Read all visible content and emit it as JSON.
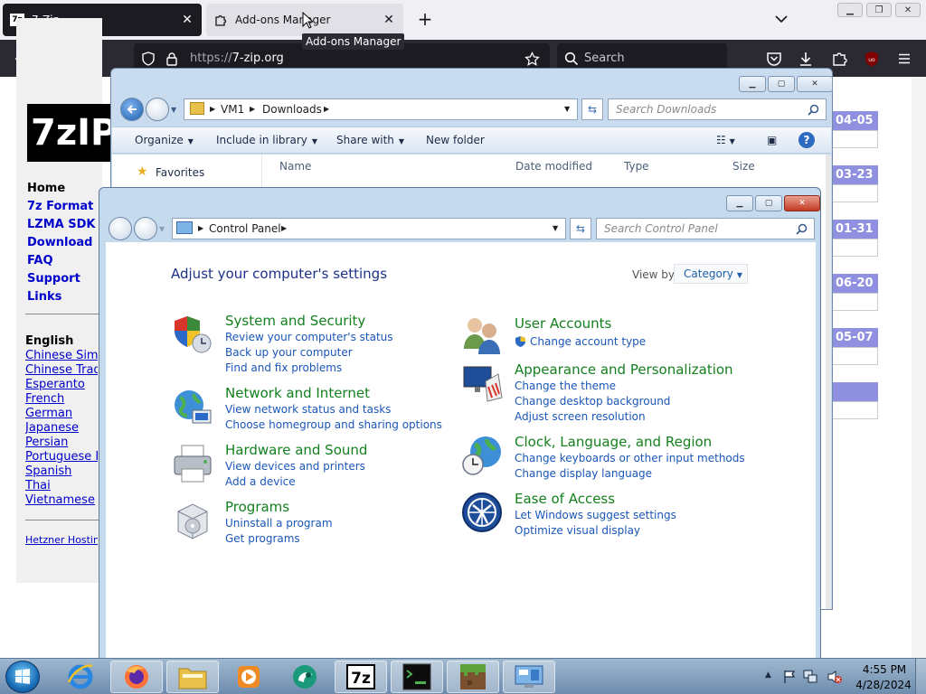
{
  "firefox": {
    "tabs": [
      {
        "label": "7-Zip",
        "icon": "7z-favicon"
      },
      {
        "label": "Add-ons Manager",
        "icon": "puzzle-icon"
      }
    ],
    "tooltip": "Add-ons Manager",
    "url": {
      "scheme": "https://",
      "host": "7-zip.org"
    },
    "search_placeholder": "Search"
  },
  "page": {
    "logo_text": "7zIP",
    "nav": [
      "Home",
      "7z Format",
      "LZMA SDK",
      "Download",
      "FAQ",
      "Support",
      "Links"
    ],
    "lang_heading": "English",
    "languages": [
      "Chinese Simp",
      "Chinese Trad",
      "Esperanto",
      "French",
      "German",
      "Japanese",
      "Persian",
      "Portuguese B",
      "Spanish",
      "Thai",
      "Vietnamese"
    ],
    "hosting": "Hetzner Hostin",
    "dates": [
      "04-05",
      "03-23",
      "01-31",
      "06-20",
      "05-07"
    ]
  },
  "explorer": {
    "breadcrumb": [
      "VM1",
      "Downloads"
    ],
    "search_placeholder": "Search Downloads",
    "commands": [
      "Organize",
      "Include in library",
      "Share with",
      "New folder"
    ],
    "favorites": "Favorites",
    "columns": [
      "Name",
      "Date modified",
      "Type",
      "Size"
    ]
  },
  "control_panel": {
    "breadcrumb": [
      "Control Panel"
    ],
    "search_placeholder": "Search Control Panel",
    "heading": "Adjust your computer's settings",
    "view_by_label": "View by:",
    "view_by_value": "Category",
    "categories_left": [
      {
        "title": "System and Security",
        "links": [
          "Review your computer's status",
          "Back up your computer",
          "Find and fix problems"
        ]
      },
      {
        "title": "Network and Internet",
        "links": [
          "View network status and tasks",
          "Choose homegroup and sharing options"
        ]
      },
      {
        "title": "Hardware and Sound",
        "links": [
          "View devices and printers",
          "Add a device"
        ]
      },
      {
        "title": "Programs",
        "links": [
          "Uninstall a program",
          "Get programs"
        ]
      }
    ],
    "categories_right": [
      {
        "title": "User Accounts",
        "links": [
          "Change account type"
        ]
      },
      {
        "title": "Appearance and Personalization",
        "links": [
          "Change the theme",
          "Change desktop background",
          "Adjust screen resolution"
        ]
      },
      {
        "title": "Clock, Language, and Region",
        "links": [
          "Change keyboards or other input methods",
          "Change display language"
        ]
      },
      {
        "title": "Ease of Access",
        "links": [
          "Let Windows suggest settings",
          "Optimize visual display"
        ]
      }
    ]
  },
  "taskbar": {
    "apps": [
      "internet-explorer-icon",
      "firefox-icon",
      "explorer-folder-icon",
      "media-player-icon",
      "browser-green-icon",
      "7zip-icon",
      "terminal-icon",
      "minecraft-icon",
      "control-panel-icon"
    ],
    "time": "4:55 PM",
    "date": "4/28/2024"
  }
}
